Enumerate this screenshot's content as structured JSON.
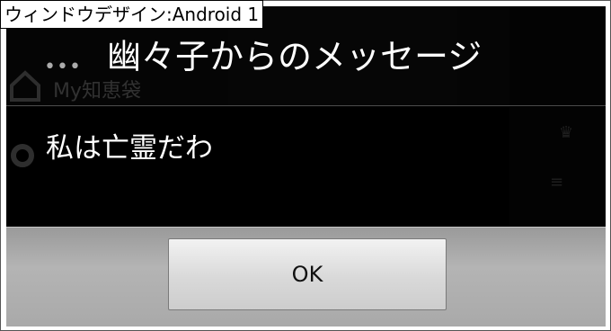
{
  "caption": "ウィンドウデザイン:Android 1",
  "background_app": {
    "title": "My知恵袋"
  },
  "dialog": {
    "title": "幽々子からのメッセージ",
    "message": "私は亡霊だわ",
    "ok_label": "OK"
  },
  "colors": {
    "dialog_background": "#000000",
    "button_bar": "#aaaaaa",
    "text": "#ffffff"
  }
}
